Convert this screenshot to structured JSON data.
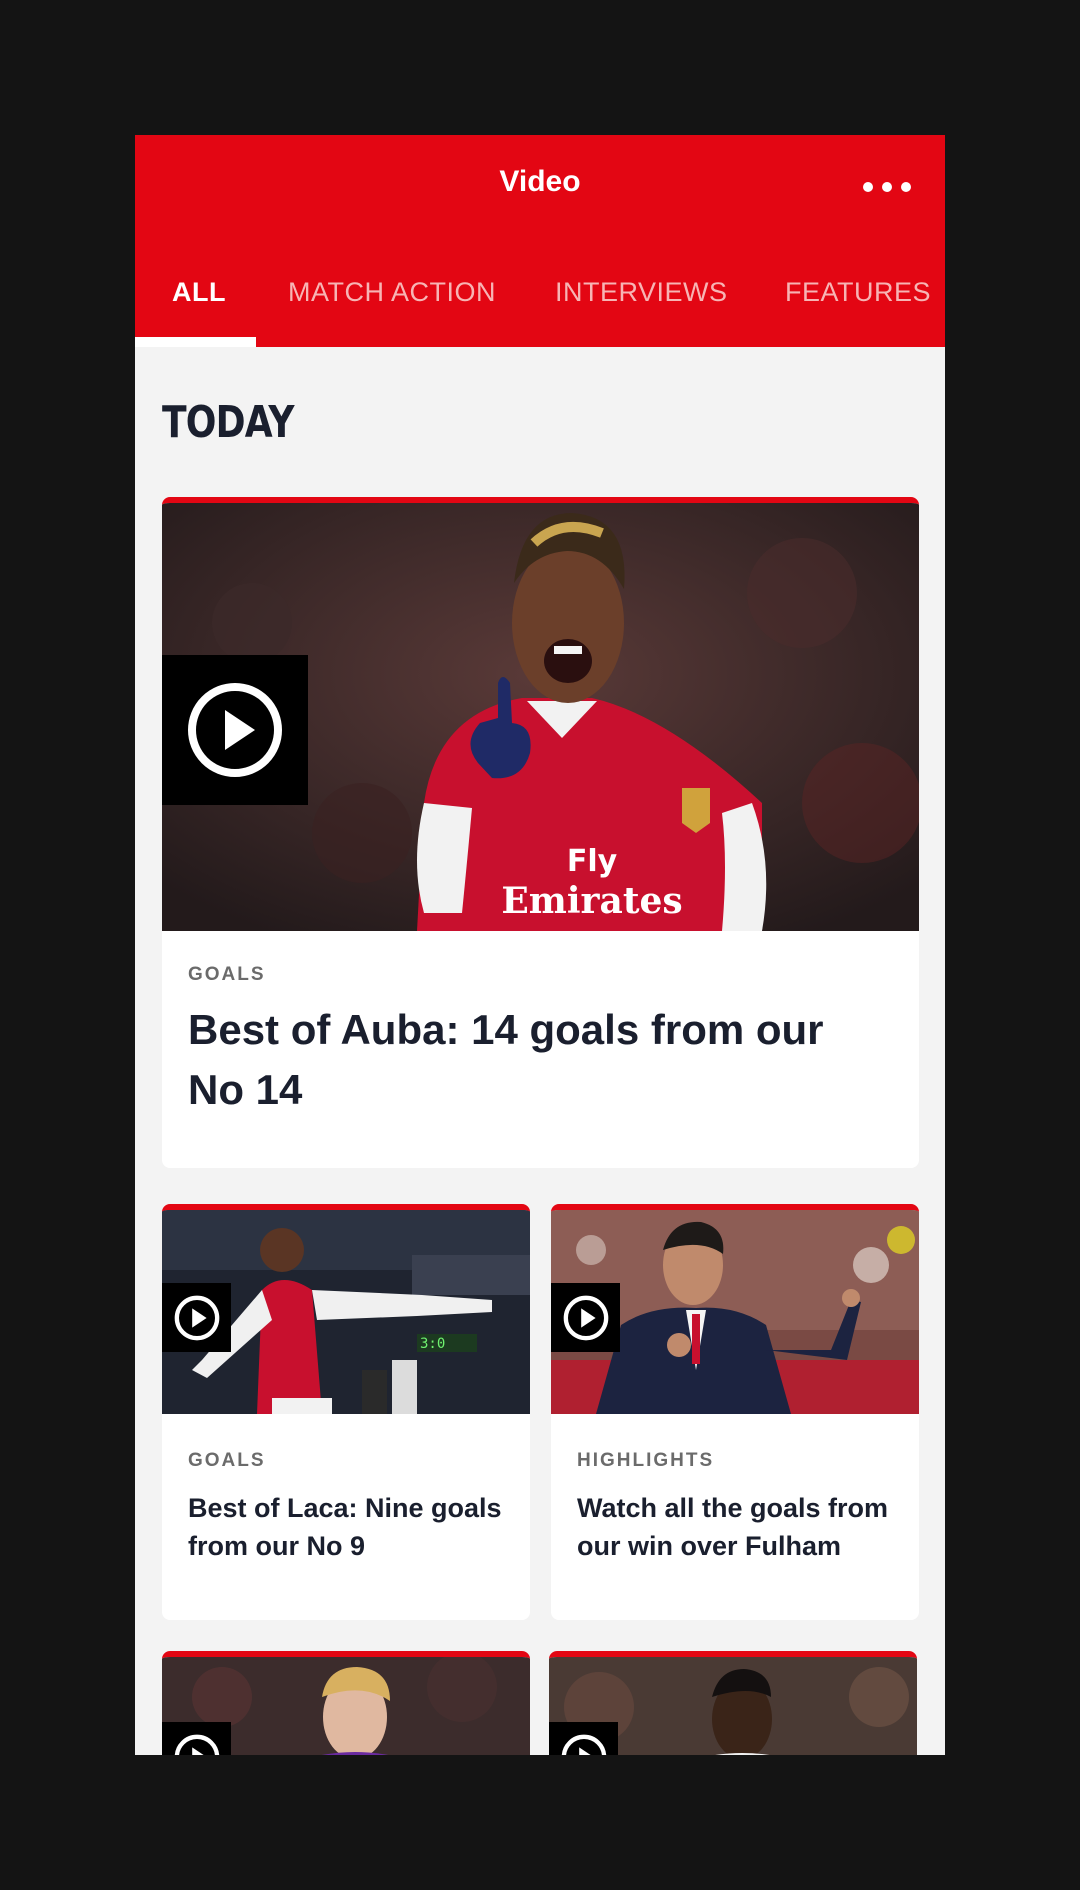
{
  "header": {
    "title": "Video",
    "tabs": [
      "ALL",
      "MATCH ACTION",
      "INTERVIEWS",
      "FEATURES"
    ],
    "active_tab": 0
  },
  "section": {
    "title": "TODAY"
  },
  "cards": [
    {
      "tag": "GOALS",
      "headline": "Best of Auba: 14 goals from our No 14"
    },
    {
      "tag": "GOALS",
      "headline": "Best of Laca: Nine goals from our No 9"
    },
    {
      "tag": "HIGHLIGHTS",
      "headline": "Watch all the goals from our win over Fulham"
    }
  ],
  "colors": {
    "accent": "#e30613",
    "background": "#f3f3f3",
    "text": "#1a1f2e"
  },
  "icons": [
    "more-icon",
    "play-icon"
  ]
}
